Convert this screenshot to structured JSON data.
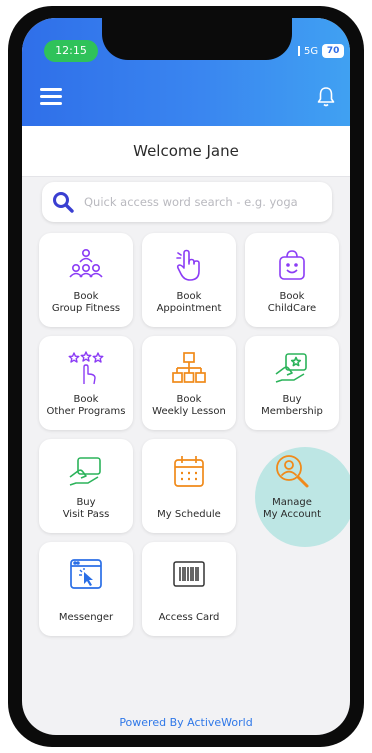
{
  "status": {
    "time": "12:15",
    "network": "5G",
    "battery": "70"
  },
  "header": {
    "welcome": "Welcome Jane"
  },
  "search": {
    "placeholder": "Quick access word search - e.g. yoga"
  },
  "tiles": [
    {
      "label": "Book\nGroup Fitness",
      "icon": "group-fitness-icon",
      "color": "#8b3cf5"
    },
    {
      "label": "Book\nAppointment",
      "icon": "hand-pointer-icon",
      "color": "#8b3cf5"
    },
    {
      "label": "Book\nChildCare",
      "icon": "childcare-bag-icon",
      "color": "#8b3cf5"
    },
    {
      "label": "Book\nOther Programs",
      "icon": "stars-hand-icon",
      "color": "#8b3cf5"
    },
    {
      "label": "Book\nWeekly Lesson",
      "icon": "org-chart-icon",
      "color": "#f08a1a"
    },
    {
      "label": "Buy\nMembership",
      "icon": "membership-card-icon",
      "color": "#2bb35a"
    },
    {
      "label": "Buy\nVisit Pass",
      "icon": "visit-pass-icon",
      "color": "#2bb35a"
    },
    {
      "label": "My Schedule",
      "icon": "calendar-icon",
      "color": "#f08a1a"
    },
    {
      "label": "Manage\nMy Account",
      "icon": "account-search-icon",
      "color": "#f08a1a"
    },
    {
      "label": "Messenger",
      "icon": "messenger-icon",
      "color": "#2b6fe6"
    },
    {
      "label": "Access Card",
      "icon": "barcode-icon",
      "color": "#333333"
    }
  ],
  "footer": {
    "text": "Powered By ActiveWorld"
  }
}
